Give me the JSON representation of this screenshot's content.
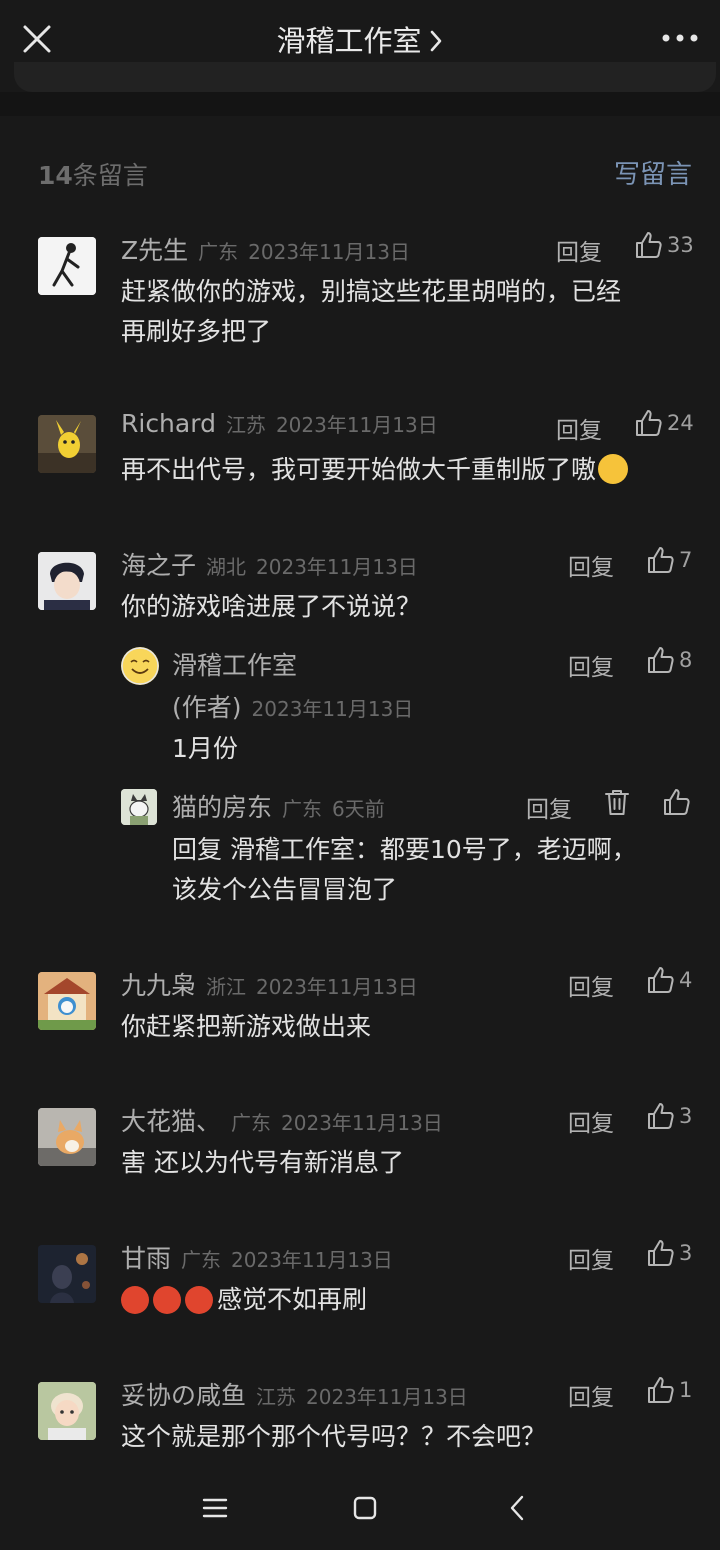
{
  "topbar": {
    "title": "滑稽工作室"
  },
  "header": {
    "count_num": "14",
    "count_suffix": "条留言",
    "write_label": "写留言"
  },
  "comments": [
    {
      "name": "Z先生",
      "loc": "广东",
      "date": "2023年11月13日",
      "reply": "回复",
      "likes": "33",
      "text": [
        "赶紧做你的游戏，别搞这些花里胡哨的，已经",
        "再刷好多把了"
      ]
    },
    {
      "name": "Richard",
      "loc": "江苏",
      "date": "2023年11月13日",
      "reply": "回复",
      "likes": "24",
      "text": [
        "再不出代号，我可要开始做大千重制版了嗷"
      ]
    },
    {
      "name": "海之子",
      "loc": "湖北",
      "date": "2023年11月13日",
      "reply": "回复",
      "likes": "7",
      "text": [
        "你的游戏啥进展了不说说？"
      ],
      "replies": [
        {
          "name": "滑稽工作室",
          "author_tag": "(作者)",
          "date": "2023年11月13日",
          "reply": "回复",
          "likes": "8",
          "text": [
            "1月份"
          ]
        },
        {
          "name": "猫的房东",
          "loc": "广东",
          "date": "6天前",
          "reply": "回复",
          "text": [
            "回复 滑稽工作室：都要10号了，老迈啊，",
            "该发个公告冒冒泡了"
          ]
        }
      ]
    },
    {
      "name": "九九枭",
      "loc": "浙江",
      "date": "2023年11月13日",
      "reply": "回复",
      "likes": "4",
      "text": [
        "你赶紧把新游戏做出来"
      ]
    },
    {
      "name": "大花猫、",
      "loc": "广东",
      "date": "2023年11月13日",
      "reply": "回复",
      "likes": "3",
      "text": [
        "害 还以为代号有新消息了"
      ]
    },
    {
      "name": "甘雨",
      "loc": "广东",
      "date": "2023年11月13日",
      "reply": "回复",
      "likes": "3",
      "text": [
        "感觉不如再刷"
      ]
    },
    {
      "name": "妥协の咸鱼",
      "loc": "江苏",
      "date": "2023年11月13日",
      "reply": "回复",
      "likes": "1",
      "text": [
        "这个就是那个那个代号吗？？不会吧？"
      ]
    }
  ],
  "colors": {
    "bg": "#191919",
    "link": "#7b94b5",
    "emoji_angry": "#e0452e",
    "emoji_shy": "#f6c33a"
  }
}
